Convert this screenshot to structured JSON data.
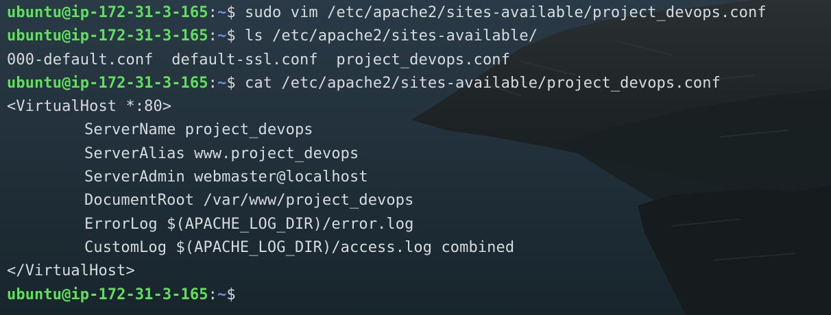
{
  "terminal": {
    "prompt": {
      "user_host": "ubuntu@ip-172-31-3-165",
      "colon": ":",
      "path": "~",
      "symbol": "$"
    },
    "lines": [
      {
        "type": "cmd",
        "text": " sudo vim /etc/apache2/sites-available/project_devops.conf"
      },
      {
        "type": "cmd",
        "text": " ls /etc/apache2/sites-available/"
      },
      {
        "type": "out",
        "text": "000-default.conf  default-ssl.conf  project_devops.conf"
      },
      {
        "type": "cmd",
        "text": " cat /etc/apache2/sites-available/project_devops.conf"
      },
      {
        "type": "out",
        "text": "<VirtualHost *:80>"
      },
      {
        "type": "indent",
        "text": "ServerName project_devops"
      },
      {
        "type": "indent",
        "text": "ServerAlias www.project_devops"
      },
      {
        "type": "indent",
        "text": "ServerAdmin webmaster@localhost"
      },
      {
        "type": "indent",
        "text": "DocumentRoot /var/www/project_devops"
      },
      {
        "type": "indent",
        "text": "ErrorLog $(APACHE_LOG_DIR)/error.log"
      },
      {
        "type": "indent",
        "text": "CustomLog $(APACHE_LOG_DIR)/access.log combined"
      },
      {
        "type": "out",
        "text": "</VirtualHost>"
      },
      {
        "type": "cmd",
        "text": ""
      }
    ]
  },
  "colors": {
    "user_host": "#5fe15b",
    "path": "#6f8fe8",
    "text": "#d6dbe0",
    "background": "#1f2a33"
  }
}
